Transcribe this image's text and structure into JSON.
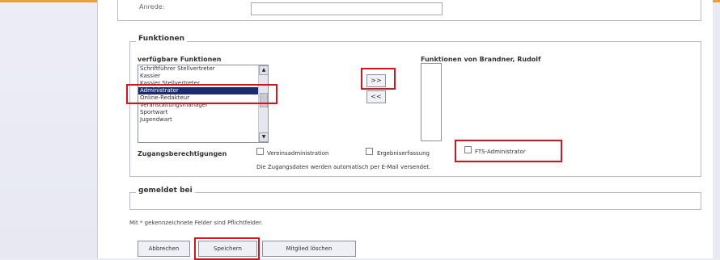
{
  "window": {
    "top_field_label": "Anrede:",
    "sections": {
      "functions": "Funktionen",
      "gemeldet": "gemeldet bei"
    }
  },
  "functions": {
    "available_label": "verfügbare Funktionen",
    "assigned_label": "Funktionen von Brandner, Rudolf",
    "available_items": [
      "Schriftführer Stellvertreter",
      "Kassier",
      "Kassier Stellvertreter",
      "Administrator",
      "Online-Redakteur",
      "Veranstaltungsmanager",
      "Sportwart",
      "Jugendwart"
    ],
    "selected_index": 3,
    "move_right_label": ">>",
    "move_left_label": "<<"
  },
  "permissions": {
    "label": "Zugangsberechtigungen",
    "options": [
      {
        "name": "Vereinsadministration",
        "checked": false
      },
      {
        "name": "Ergebniserfassung",
        "checked": false
      },
      {
        "name": "FTS-Administrator",
        "checked": false
      }
    ],
    "note": "Die Zugangsdaten werden automatisch per E-Mail versendet."
  },
  "form": {
    "hint": "Mit * gekennzeichnete Felder sind Pflichtfelder.",
    "buttons": {
      "cancel": "Abbrechen",
      "save": "Speichern",
      "delete": "Mitglied löschen"
    }
  },
  "colors": {
    "highlight_red": "#d2151f",
    "selection_blue": "#1e2a6b",
    "top_accent": "#e7a13c"
  }
}
